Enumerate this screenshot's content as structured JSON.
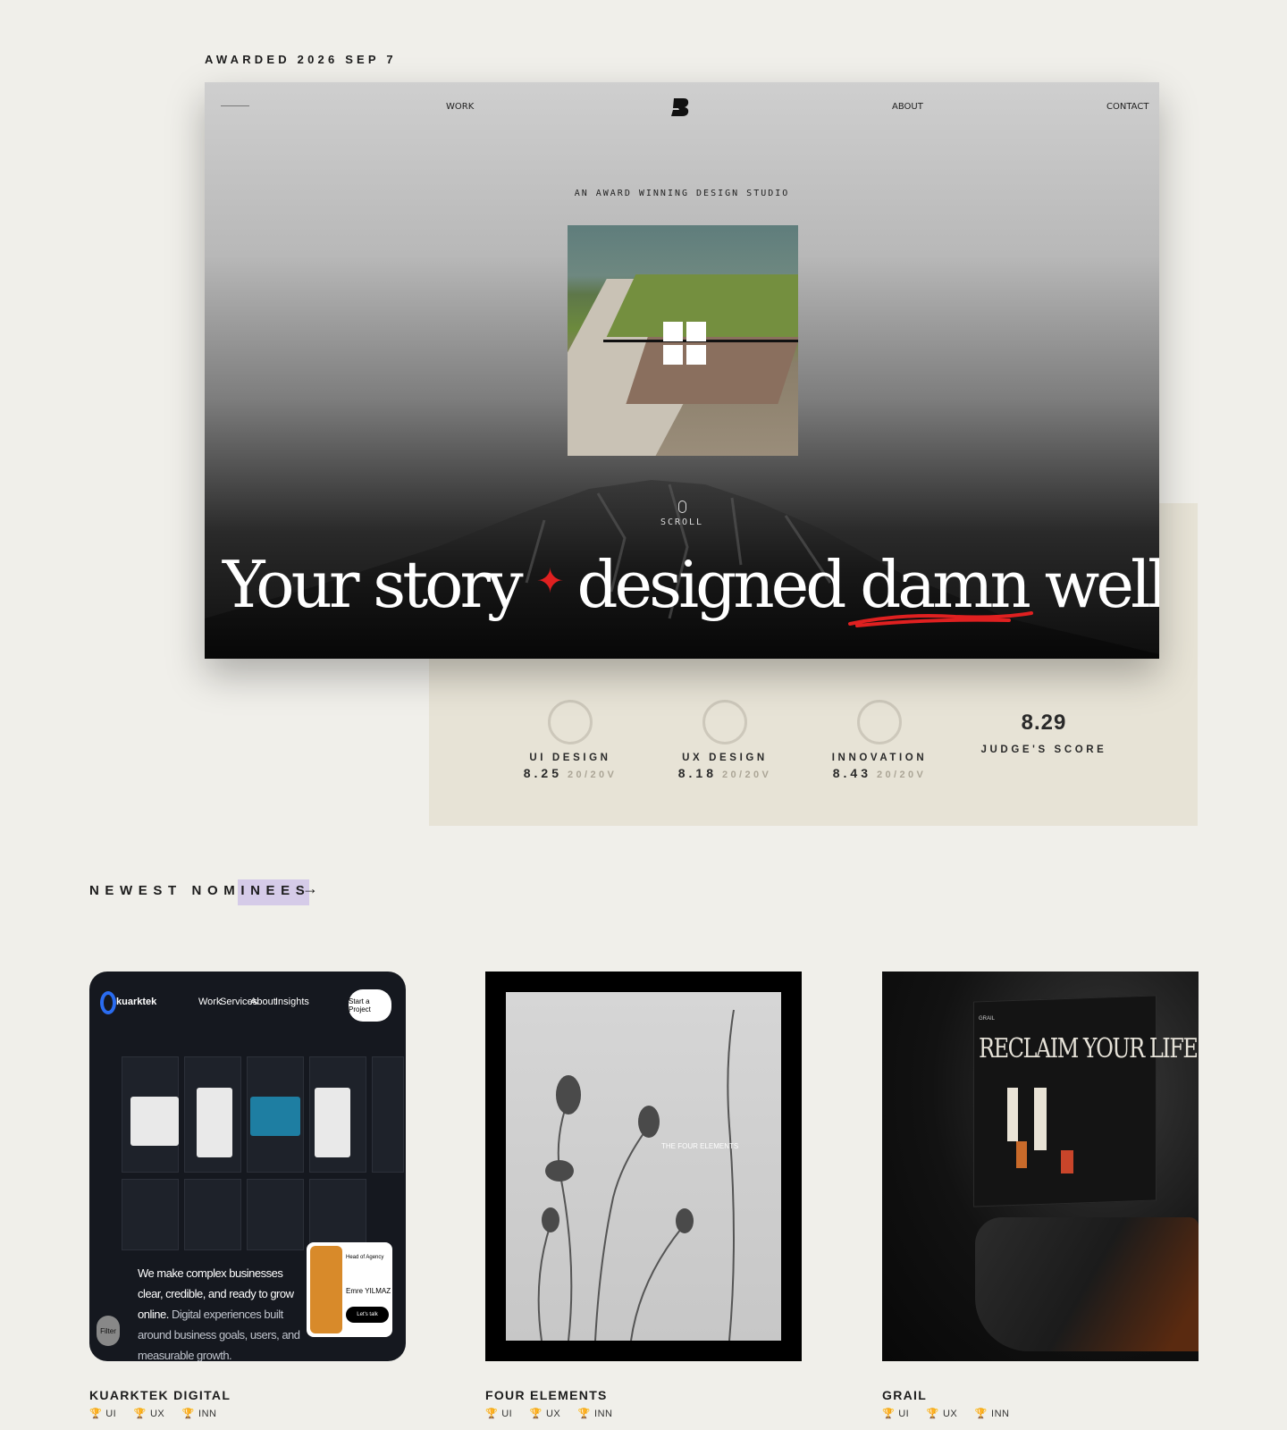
{
  "awarded": "AWARDED 2026 SEP 7",
  "hero": {
    "nav": {
      "work": "WORK",
      "about": "ABOUT",
      "contact": "CONTACT"
    },
    "tagline": "AN AWARD WINNING DESIGN STUDIO",
    "scroll": "SCROLL",
    "headline_left": "Your story",
    "headline_right": "designed damn well"
  },
  "scores": [
    {
      "name": "UI DESIGN",
      "value": "8.25",
      "sub": "20/20V"
    },
    {
      "name": "UX DESIGN",
      "value": "8.18",
      "sub": "20/20V"
    },
    {
      "name": "INNOVATION",
      "value": "8.43",
      "sub": "20/20V"
    }
  ],
  "judge": {
    "score": "8.29",
    "label": "JUDGE'S SCORE"
  },
  "nominees": {
    "heading": "NEWEST NOMINEES",
    "arrow": "→",
    "items": [
      {
        "title": "KUARKTEK DIGITAL",
        "tags": [
          "UI",
          "UX",
          "INN"
        ],
        "thumb": {
          "brand": "kuarktek",
          "nav": [
            "Work",
            "Services",
            "About",
            "Insights"
          ],
          "cta": "Start a Project",
          "text_bright": "We make complex businesses clear, credible, and ready to grow online.",
          "text_dim": "Digital experiences built around business goals, users, and measurable growth.",
          "person_role": "Head of Agency",
          "person_name": "Emre YILMAZ",
          "person_cta": "Let's talk",
          "filter": "Filter"
        }
      },
      {
        "title": "FOUR ELEMENTS",
        "tags": [
          "UI",
          "UX",
          "INN"
        ],
        "thumb": {
          "heading": "THE FOUR ELEMENTS"
        }
      },
      {
        "title": "GRAIL",
        "tags": [
          "UI",
          "UX",
          "INN"
        ],
        "thumb": {
          "heading": "RECLAIM YOUR LIFE",
          "brand": "GRAIL"
        }
      }
    ]
  },
  "colors": {
    "background": "#f0efea",
    "panel": "#e7e3d6",
    "highlight": "#d5cbe8",
    "accent_red": "#e02020"
  }
}
